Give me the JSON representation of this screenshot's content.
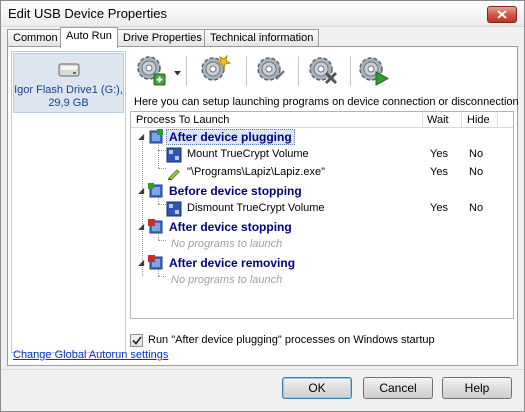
{
  "window": {
    "title": "Edit USB Device Properties"
  },
  "tabs": [
    {
      "label": "Common"
    },
    {
      "label": "Auto Run",
      "active": true
    },
    {
      "label": "Drive Properties"
    },
    {
      "label": "Technical information"
    }
  ],
  "devices": [
    {
      "name": "Igor Flash Drive1 (G:), 29,9 GB",
      "icon": "usb-drive-icon"
    }
  ],
  "toolbar": {
    "icons": [
      "add-program-gear-icon",
      "dropdown-arrow-icon",
      "edit-gear-icon",
      "properties-gear-icon",
      "delete-gear-icon",
      "run-gear-icon"
    ]
  },
  "info_text": "Here you can setup launching programs on device connection or disconnection",
  "tree": {
    "columns": {
      "process": "Process To Launch",
      "wait": "Wait",
      "hide": "Hide"
    },
    "groups": [
      {
        "label": "After device plugging",
        "icon": "plug-in-icon",
        "items": [
          {
            "label": "Mount TrueCrypt Volume",
            "wait": "Yes",
            "hide": "No",
            "icon": "truecrypt-icon"
          },
          {
            "label": "\"\\Programs\\Lapiz\\Lapiz.exe\"",
            "wait": "Yes",
            "hide": "No",
            "icon": "pencil-icon"
          }
        ]
      },
      {
        "label": "Before device stopping",
        "icon": "stop-pre-icon",
        "items": [
          {
            "label": "Dismount TrueCrypt Volume",
            "wait": "Yes",
            "hide": "No",
            "icon": "truecrypt-icon"
          }
        ]
      },
      {
        "label": "After device stopping",
        "icon": "stopped-icon",
        "empty_note": "No programs to launch"
      },
      {
        "label": "After device removing",
        "icon": "removed-icon",
        "empty_note": "No programs to launch"
      }
    ]
  },
  "startup_checkbox": {
    "label": "Run \"After device plugging\" processes on Windows startup",
    "checked": true
  },
  "global_link": "Change Global Autorun settings",
  "buttons": {
    "ok": "OK",
    "cancel": "Cancel",
    "help": "Help"
  },
  "colors": {
    "group_text": "#000080",
    "link": "#0033cc",
    "close_red": "#c1321f",
    "empty_note": "#a0a0a0"
  }
}
